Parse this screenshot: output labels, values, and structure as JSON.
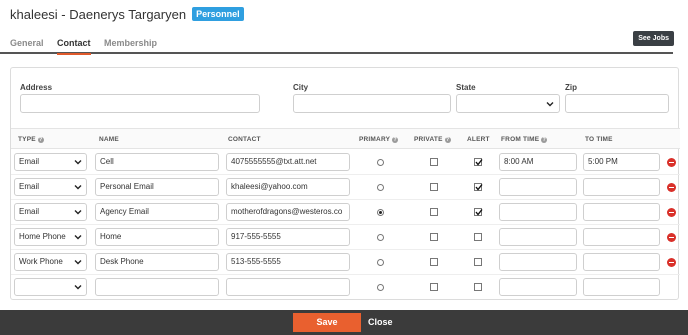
{
  "header": {
    "title": "khaleesi - Daenerys Targaryen",
    "badge": "Personnel"
  },
  "tabs": [
    {
      "label": "General",
      "active": false
    },
    {
      "label": "Contact",
      "active": true
    },
    {
      "label": "Membership",
      "active": false
    }
  ],
  "see_jobs_label": "See Jobs",
  "address": {
    "labels": {
      "address": "Address",
      "city": "City",
      "state": "State",
      "zip": "Zip"
    },
    "values": {
      "address": "",
      "city": "",
      "state": "",
      "zip": ""
    }
  },
  "table": {
    "headers": {
      "type": "TYPE",
      "name": "NAME",
      "contact": "CONTACT",
      "primary": "PRIMARY",
      "private": "PRIVATE",
      "alert": "ALERT",
      "from_time": "FROM TIME",
      "to_time": "TO TIME"
    },
    "rows": [
      {
        "type": "Email",
        "name": "Cell",
        "contact": "4075555555@txt.att.net",
        "primary": false,
        "private": false,
        "alert": true,
        "from_time": "8:00 AM",
        "to_time": "5:00 PM"
      },
      {
        "type": "Email",
        "name": "Personal Email",
        "contact": "khaleesi@yahoo.com",
        "primary": false,
        "private": false,
        "alert": true,
        "from_time": "",
        "to_time": ""
      },
      {
        "type": "Email",
        "name": "Agency Email",
        "contact": "motherofdragons@westeros.co",
        "primary": true,
        "private": false,
        "alert": true,
        "from_time": "",
        "to_time": ""
      },
      {
        "type": "Home Phone",
        "name": "Home",
        "contact": "917-555-5555",
        "primary": false,
        "private": false,
        "alert": false,
        "from_time": "",
        "to_time": ""
      },
      {
        "type": "Work Phone",
        "name": "Desk Phone",
        "contact": "513-555-5555",
        "primary": false,
        "private": false,
        "alert": false,
        "from_time": "",
        "to_time": ""
      },
      {
        "type": "",
        "name": "",
        "contact": "",
        "primary": false,
        "private": false,
        "alert": false,
        "from_time": "",
        "to_time": ""
      }
    ]
  },
  "footer": {
    "save_label": "Save",
    "close_label": "Close"
  },
  "colors": {
    "accent": "#e9602f",
    "badge": "#2f9fe0",
    "remove": "#d9302a",
    "footer": "#3b3b3b"
  }
}
